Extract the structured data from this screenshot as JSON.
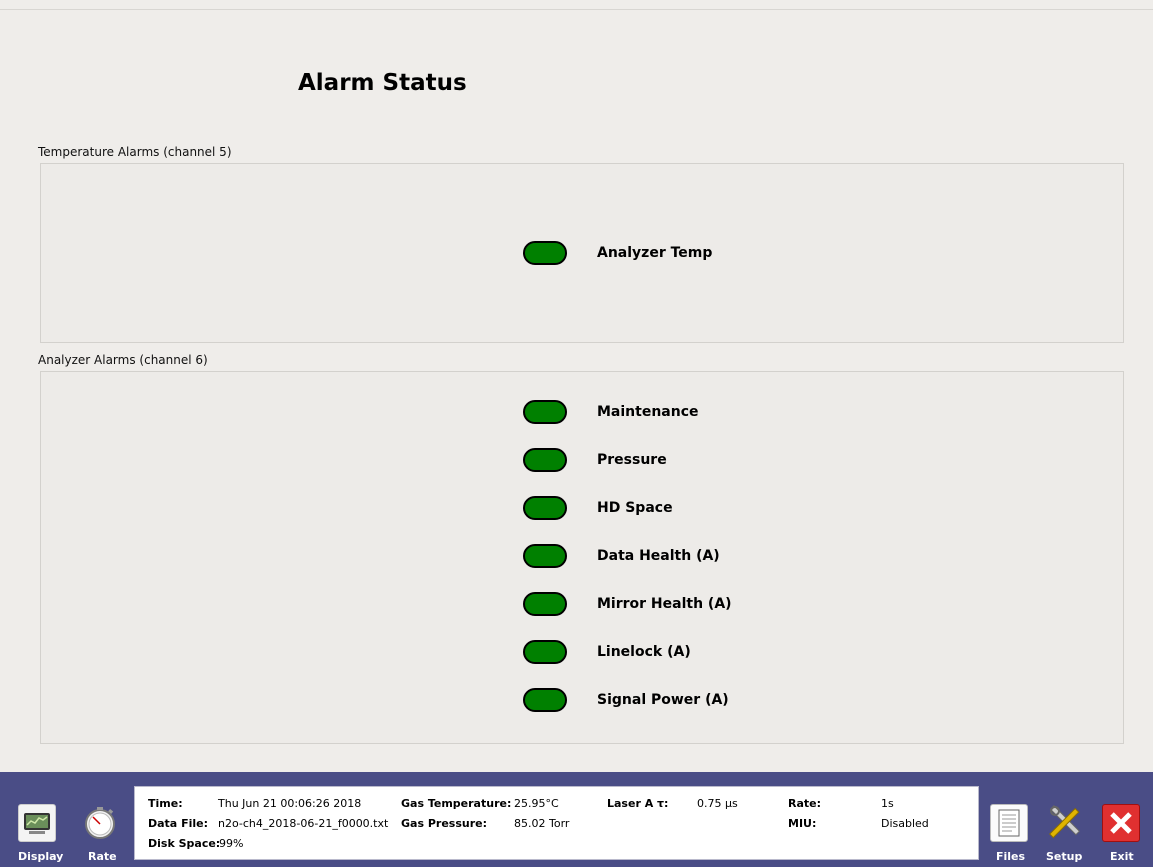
{
  "title": "Alarm Status",
  "sections": [
    {
      "label": "Temperature Alarms (channel 5)",
      "alarms": [
        {
          "label": "Analyzer Temp",
          "status_color": "#008000"
        }
      ]
    },
    {
      "label": "Analyzer Alarms (channel 6)",
      "alarms": [
        {
          "label": "Maintenance",
          "status_color": "#008000"
        },
        {
          "label": "Pressure",
          "status_color": "#008000"
        },
        {
          "label": "HD Space",
          "status_color": "#008000"
        },
        {
          "label": "Data Health (A)",
          "status_color": "#008000"
        },
        {
          "label": "Mirror Health (A)",
          "status_color": "#008000"
        },
        {
          "label": "Linelock (A)",
          "status_color": "#008000"
        },
        {
          "label": "Signal Power (A)",
          "status_color": "#008000"
        }
      ]
    }
  ],
  "toolbar": {
    "display_label": "Display",
    "rate_label": "Rate",
    "files_label": "Files",
    "setup_label": "Setup",
    "exit_label": "Exit",
    "display_icon": "monitor-icon",
    "rate_icon": "stopwatch-icon",
    "files_icon": "document-icon",
    "setup_icon": "tools-icon",
    "exit_icon": "close-icon"
  },
  "status": {
    "time_label": "Time:",
    "time_value": "Thu Jun 21 00:06:26 2018",
    "data_file_label": "Data File:",
    "data_file_value": "n2o-ch4_2018-06-21_f0000.txt",
    "disk_space_label": "Disk Space:",
    "disk_space_value": "99%",
    "gas_temp_label": "Gas Temperature:",
    "gas_temp_value": "25.95°C",
    "gas_pressure_label": "Gas Pressure:",
    "gas_pressure_value": "85.02 Torr",
    "laser_label": "Laser A τ:",
    "laser_value": "0.75  µs",
    "rate_label": "Rate:",
    "rate_value": "1s",
    "miu_label": "MIU:",
    "miu_value": "Disabled"
  },
  "colors": {
    "ok": "#008000",
    "bar": "#4a4d86",
    "exit": "#e03030"
  }
}
